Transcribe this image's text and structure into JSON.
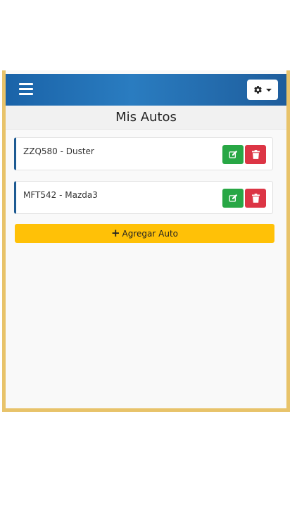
{
  "page": {
    "title": "Mis Autos"
  },
  "header": {
    "menu_icon": "hamburger-icon",
    "settings_icon": "gear-icon",
    "settings_caret_icon": "caret-down-icon"
  },
  "autos": [
    {
      "label": "ZZQ580 - Duster"
    },
    {
      "label": "MFT542 - Mazda3"
    }
  ],
  "actions": {
    "edit_icon": "edit-icon",
    "delete_icon": "trash-icon",
    "add_label": "Agregar Auto",
    "add_icon": "plus-icon"
  },
  "colors": {
    "header": "#1a63a8",
    "frame_border": "#e8c36a",
    "edit": "#28a745",
    "delete": "#dc3545",
    "add": "#ffc107",
    "card_accent": "#1d5a92"
  }
}
